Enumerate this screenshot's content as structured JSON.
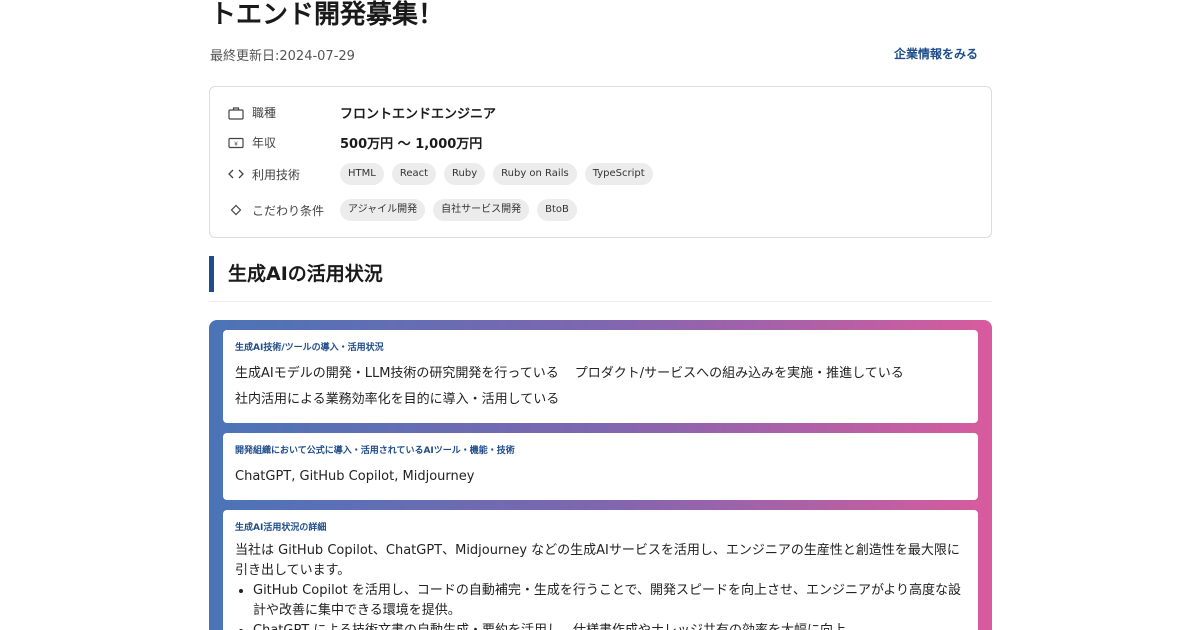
{
  "header": {
    "title": "トエンド開発募集！",
    "updated": "最終更新日:2024-07-29",
    "company_link": "企業情報をみる"
  },
  "summary": {
    "job": {
      "label": "職種",
      "value": "フロントエンドエンジニア"
    },
    "salary": {
      "label": "年収",
      "value": "500万円 〜 1,000万円"
    },
    "tech": {
      "label": "利用技術",
      "tags": [
        "HTML",
        "React",
        "Ruby",
        "Ruby on Rails",
        "TypeScript"
      ]
    },
    "prefs": {
      "label": "こだわり条件",
      "tags": [
        "アジャイル開発",
        "自社サービス開発",
        "BtoB"
      ]
    }
  },
  "section": {
    "title": "生成AIの活用状況"
  },
  "ai": {
    "status": {
      "label": "生成AI技術/ツールの導入・活用状況",
      "item1": "生成AIモデルの開発・LLM技術の研究開発を行っている",
      "item2": "プロダクト/サービスへの組み込みを実施・推進している",
      "item3": "社内活用による業務効率化を目的に導入・活用している"
    },
    "tools": {
      "label": "開発組織において公式に導入・活用されているAIツール・機能・技術",
      "text": "ChatGPT, GitHub Copilot, Midjourney"
    },
    "details": {
      "label": "生成AI活用状況の詳細",
      "intro": "当社は GitHub Copilot、ChatGPT、Midjourney などの生成AIサービスを活用し、エンジニアの生産性と創造性を最大限に引き出しています。",
      "bullet1": "GitHub Copilot を活用し、コードの自動補完・生成を行うことで、開発スピードを向上させ、エンジニアがより高度な設計や改善に集中できる環境を提供。",
      "bullet2": "ChatGPT による技術文書の自動生成・要約を活用し、仕様書作成やナレッジ共有の効率を大幅に向上。"
    }
  }
}
